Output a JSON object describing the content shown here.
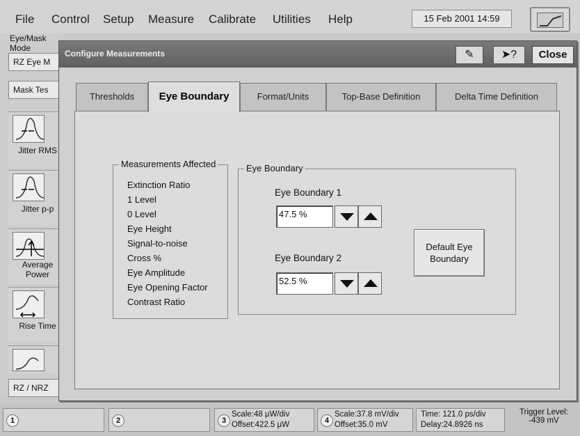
{
  "menubar": {
    "items": [
      {
        "label": "File"
      },
      {
        "label": "Control"
      },
      {
        "label": "Setup"
      },
      {
        "label": "Measure"
      },
      {
        "label": "Calibrate"
      },
      {
        "label": "Utilities"
      },
      {
        "label": "Help"
      }
    ],
    "datetime": "15 Feb 2001  14:59",
    "scope_icon": "waveform-display-icon"
  },
  "left_panel": {
    "mode_label": "Eye/Mask Mode",
    "mode_button": "RZ Eye M",
    "mask_button": "Mask Tes",
    "items": [
      {
        "label": "Jitter RMS",
        "icon": "jitter-rms-icon"
      },
      {
        "label": "Jitter p-p",
        "icon": "jitter-pp-icon"
      },
      {
        "label": "Average Power",
        "icon": "average-power-icon"
      },
      {
        "label": "Rise Time",
        "icon": "rise-time-icon"
      },
      {
        "label": "",
        "icon": "fall-time-icon"
      }
    ],
    "rz_toggle": "RZ / NRZ"
  },
  "dialog": {
    "title": "Configure Measurements",
    "close_label": "Close",
    "tabs": [
      {
        "label": "Thresholds"
      },
      {
        "label": "Eye Boundary"
      },
      {
        "label": "Format/Units"
      },
      {
        "label": "Top-Base Definition"
      },
      {
        "label": "Delta Time Definition"
      }
    ],
    "active_tab": "Eye Boundary",
    "affected": {
      "legend": "Measurements Affected",
      "items": [
        "Extinction Ratio",
        "1 Level",
        "0 Level",
        "Eye Height",
        "Signal-to-noise",
        "Cross %",
        "Eye Amplitude",
        "Eye Opening Factor",
        "Contrast Ratio"
      ]
    },
    "eye_boundary": {
      "legend": "Eye Boundary",
      "boundary1_label": "Eye Boundary 1",
      "boundary1_value": "47.5 %",
      "boundary2_label": "Eye Boundary 2",
      "boundary2_value": "52.5 %",
      "default_button_line1": "Default Eye",
      "default_button_line2": "Boundary"
    }
  },
  "status": {
    "ch1": "1",
    "ch2": "2",
    "ch3_num": "3",
    "ch3_scale": "Scale:48 µW/div",
    "ch3_offset": "Offset:422.5 µW",
    "ch4_num": "4",
    "ch4_scale": "Scale:37.8 mV/div",
    "ch4_offset": "Offset:35.0 mV",
    "time": "Time:  121.0 ps/div",
    "delay": "Delay:24.8926 ns",
    "trigger_label": "Trigger Level:",
    "trigger_value": "-439 mV"
  }
}
